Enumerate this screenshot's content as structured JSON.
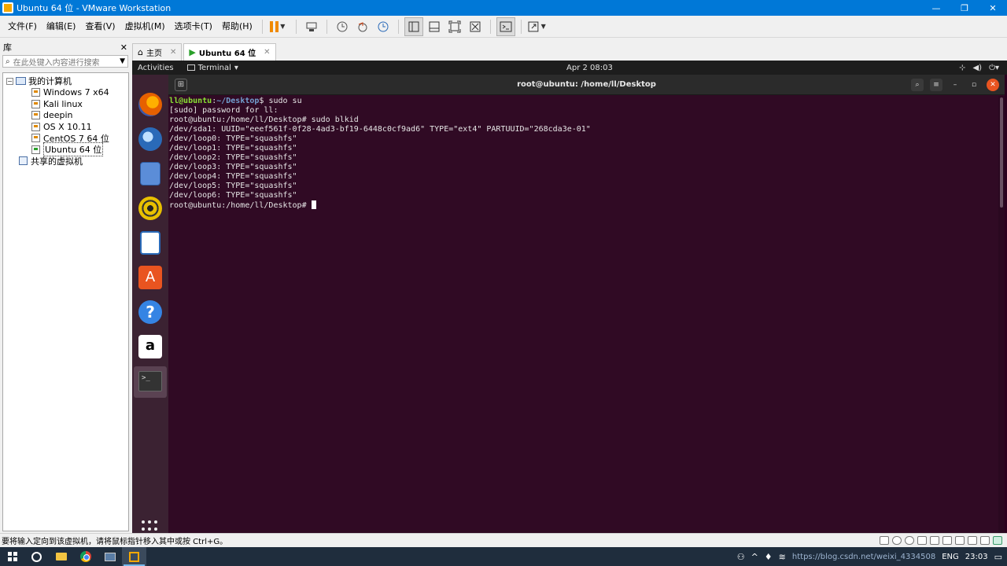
{
  "window": {
    "title": "Ubuntu 64 位 - VMware Workstation",
    "minimize": "—",
    "maximize": "❐",
    "close": "✕"
  },
  "menubar": {
    "items": [
      "文件(F)",
      "编辑(E)",
      "查看(V)",
      "虚拟机(M)",
      "选项卡(T)",
      "帮助(H)"
    ]
  },
  "library": {
    "title": "库",
    "close": "✕",
    "search_placeholder": "在此处键入内容进行搜索",
    "tree": {
      "root_label": "我的计算机",
      "vms": [
        "Windows 7 x64",
        "Kali linux",
        "deepin",
        "OS X 10.11",
        "CentOS 7 64 位",
        "Ubuntu 64 位"
      ],
      "selected_vm": "Ubuntu 64 位",
      "shared_label": "共享的虚拟机"
    }
  },
  "tabs": [
    {
      "label": "主页",
      "icon": "home-icon",
      "close": "✕"
    },
    {
      "label": "Ubuntu 64 位",
      "icon": "vm-running-icon",
      "close": "✕"
    }
  ],
  "ubuntu": {
    "topbar": {
      "activities": "Activities",
      "app_menu": "Terminal",
      "app_menu_arrow": "▾",
      "clock": "Apr 2  08:03",
      "tray_icons": [
        "network-icon",
        "volume-icon",
        "power-icon"
      ]
    },
    "dock": {
      "apps": [
        "firefox-icon",
        "thunderbird-icon",
        "files-icon",
        "rhythmbox-icon",
        "libreoffice-writer-icon",
        "ubuntu-software-icon",
        "help-icon",
        "amazon-icon",
        "terminal-icon"
      ],
      "terminal_glyph": ">_",
      "amazon_glyph": "a",
      "help_glyph": "?"
    },
    "terminal": {
      "title": "root@ubuntu: /home/ll/Desktop",
      "newtab_glyph": "⊞",
      "search_glyph": "⌕",
      "menu_glyph": "≡",
      "minimize_glyph": "–",
      "maximize_glyph": "▫",
      "close_glyph": "✕",
      "prompt_user": "ll@ubuntu",
      "prompt_path": "~/Desktop",
      "first_command": "$ sudo su",
      "lines": [
        "[sudo] password for ll:",
        "root@ubuntu:/home/ll/Desktop# sudo blkid",
        "/dev/sda1: UUID=\"eeef561f-0f28-4ad3-bf19-6448c0cf9ad6\" TYPE=\"ext4\" PARTUUID=\"268cda3e-01\"",
        "/dev/loop0: TYPE=\"squashfs\"",
        "/dev/loop1: TYPE=\"squashfs\"",
        "/dev/loop2: TYPE=\"squashfs\"",
        "/dev/loop3: TYPE=\"squashfs\"",
        "/dev/loop4: TYPE=\"squashfs\"",
        "/dev/loop5: TYPE=\"squashfs\"",
        "/dev/loop6: TYPE=\"squashfs\""
      ],
      "final_prompt": "root@ubuntu:/home/ll/Desktop# "
    }
  },
  "statusbar": {
    "message": "要将输入定向到该虚拟机，请将鼠标指针移入其中或按 Ctrl+G。"
  },
  "taskbar": {
    "watermark": "https://blog.csdn.net/weixi_4334508",
    "ime": "ENG",
    "time": "23:03"
  },
  "colors": {
    "titlebar": "#0078d7",
    "ubuntu_bg": "#2c001e",
    "terminal_bg": "#300a24",
    "prompt_user": "#8ae234",
    "prompt_path": "#729fcf",
    "ubuntu_orange": "#e95420"
  }
}
